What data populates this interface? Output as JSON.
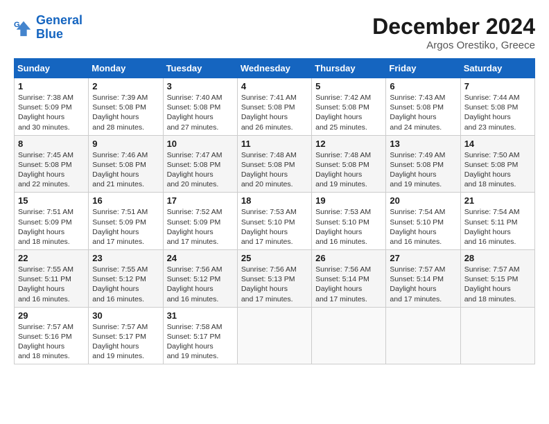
{
  "header": {
    "logo_line1": "General",
    "logo_line2": "Blue",
    "month": "December 2024",
    "location": "Argos Orestiko, Greece"
  },
  "days_of_week": [
    "Sunday",
    "Monday",
    "Tuesday",
    "Wednesday",
    "Thursday",
    "Friday",
    "Saturday"
  ],
  "weeks": [
    [
      {
        "day": "1",
        "sunrise": "7:38 AM",
        "sunset": "5:09 PM",
        "daylight": "9 hours and 30 minutes."
      },
      {
        "day": "2",
        "sunrise": "7:39 AM",
        "sunset": "5:08 PM",
        "daylight": "9 hours and 28 minutes."
      },
      {
        "day": "3",
        "sunrise": "7:40 AM",
        "sunset": "5:08 PM",
        "daylight": "9 hours and 27 minutes."
      },
      {
        "day": "4",
        "sunrise": "7:41 AM",
        "sunset": "5:08 PM",
        "daylight": "9 hours and 26 minutes."
      },
      {
        "day": "5",
        "sunrise": "7:42 AM",
        "sunset": "5:08 PM",
        "daylight": "9 hours and 25 minutes."
      },
      {
        "day": "6",
        "sunrise": "7:43 AM",
        "sunset": "5:08 PM",
        "daylight": "9 hours and 24 minutes."
      },
      {
        "day": "7",
        "sunrise": "7:44 AM",
        "sunset": "5:08 PM",
        "daylight": "9 hours and 23 minutes."
      }
    ],
    [
      {
        "day": "8",
        "sunrise": "7:45 AM",
        "sunset": "5:08 PM",
        "daylight": "9 hours and 22 minutes."
      },
      {
        "day": "9",
        "sunrise": "7:46 AM",
        "sunset": "5:08 PM",
        "daylight": "9 hours and 21 minutes."
      },
      {
        "day": "10",
        "sunrise": "7:47 AM",
        "sunset": "5:08 PM",
        "daylight": "9 hours and 20 minutes."
      },
      {
        "day": "11",
        "sunrise": "7:48 AM",
        "sunset": "5:08 PM",
        "daylight": "9 hours and 20 minutes."
      },
      {
        "day": "12",
        "sunrise": "7:48 AM",
        "sunset": "5:08 PM",
        "daylight": "9 hours and 19 minutes."
      },
      {
        "day": "13",
        "sunrise": "7:49 AM",
        "sunset": "5:08 PM",
        "daylight": "9 hours and 19 minutes."
      },
      {
        "day": "14",
        "sunrise": "7:50 AM",
        "sunset": "5:08 PM",
        "daylight": "9 hours and 18 minutes."
      }
    ],
    [
      {
        "day": "15",
        "sunrise": "7:51 AM",
        "sunset": "5:09 PM",
        "daylight": "9 hours and 18 minutes."
      },
      {
        "day": "16",
        "sunrise": "7:51 AM",
        "sunset": "5:09 PM",
        "daylight": "9 hours and 17 minutes."
      },
      {
        "day": "17",
        "sunrise": "7:52 AM",
        "sunset": "5:09 PM",
        "daylight": "9 hours and 17 minutes."
      },
      {
        "day": "18",
        "sunrise": "7:53 AM",
        "sunset": "5:10 PM",
        "daylight": "9 hours and 17 minutes."
      },
      {
        "day": "19",
        "sunrise": "7:53 AM",
        "sunset": "5:10 PM",
        "daylight": "9 hours and 16 minutes."
      },
      {
        "day": "20",
        "sunrise": "7:54 AM",
        "sunset": "5:10 PM",
        "daylight": "9 hours and 16 minutes."
      },
      {
        "day": "21",
        "sunrise": "7:54 AM",
        "sunset": "5:11 PM",
        "daylight": "9 hours and 16 minutes."
      }
    ],
    [
      {
        "day": "22",
        "sunrise": "7:55 AM",
        "sunset": "5:11 PM",
        "daylight": "9 hours and 16 minutes."
      },
      {
        "day": "23",
        "sunrise": "7:55 AM",
        "sunset": "5:12 PM",
        "daylight": "9 hours and 16 minutes."
      },
      {
        "day": "24",
        "sunrise": "7:56 AM",
        "sunset": "5:12 PM",
        "daylight": "9 hours and 16 minutes."
      },
      {
        "day": "25",
        "sunrise": "7:56 AM",
        "sunset": "5:13 PM",
        "daylight": "9 hours and 17 minutes."
      },
      {
        "day": "26",
        "sunrise": "7:56 AM",
        "sunset": "5:14 PM",
        "daylight": "9 hours and 17 minutes."
      },
      {
        "day": "27",
        "sunrise": "7:57 AM",
        "sunset": "5:14 PM",
        "daylight": "9 hours and 17 minutes."
      },
      {
        "day": "28",
        "sunrise": "7:57 AM",
        "sunset": "5:15 PM",
        "daylight": "9 hours and 18 minutes."
      }
    ],
    [
      {
        "day": "29",
        "sunrise": "7:57 AM",
        "sunset": "5:16 PM",
        "daylight": "9 hours and 18 minutes."
      },
      {
        "day": "30",
        "sunrise": "7:57 AM",
        "sunset": "5:17 PM",
        "daylight": "9 hours and 19 minutes."
      },
      {
        "day": "31",
        "sunrise": "7:58 AM",
        "sunset": "5:17 PM",
        "daylight": "9 hours and 19 minutes."
      },
      null,
      null,
      null,
      null
    ]
  ]
}
